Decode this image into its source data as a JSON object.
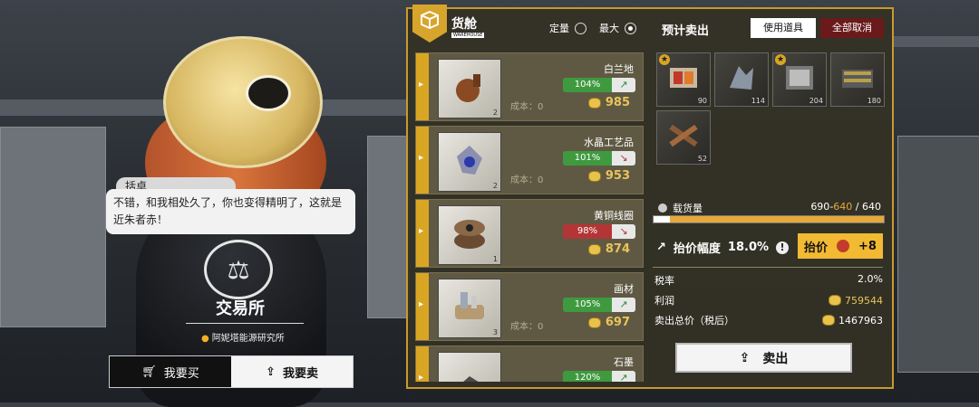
{
  "dialog": {
    "speaker": "括卓",
    "text": "不错，和我相处久了，你也变得精明了，这就是近朱者赤！"
  },
  "location": {
    "title": "交易所",
    "subtitle": "阿妮塔能源研究所"
  },
  "mode": {
    "buy_label": "我要买",
    "sell_label": "我要卖",
    "active": "sell"
  },
  "warehouse": {
    "title": "货舱",
    "badge_top": "WAREHOUSE",
    "badge_sub": "WAREHOUSE",
    "quantity_options": [
      "定量",
      "最大"
    ],
    "selected_option": "最大"
  },
  "forecast": {
    "title": "预计卖出",
    "use_item_label": "使用道具",
    "cancel_all_label": "全部取消"
  },
  "items": [
    {
      "name": "白兰地",
      "qty": "2",
      "percent": "104%",
      "trend": "up",
      "arrow": "↗",
      "cost": "成本：0",
      "price": "985"
    },
    {
      "name": "水晶工艺品",
      "qty": "2",
      "percent": "101%",
      "trend": "up",
      "arrow": "↘",
      "cost": "成本：0",
      "price": "953"
    },
    {
      "name": "黄铜线圈",
      "qty": "1",
      "percent": "98%",
      "trend": "down",
      "arrow": "↘",
      "cost": "",
      "price": "874"
    },
    {
      "name": "画材",
      "qty": "3",
      "percent": "105%",
      "trend": "up",
      "arrow": "↗",
      "cost": "成本：0",
      "price": "697"
    },
    {
      "name": "石墨",
      "qty": "",
      "percent": "120%",
      "trend": "up",
      "arrow": "↗",
      "cost": "",
      "price": ""
    }
  ],
  "sell_slots": [
    {
      "qty": "90",
      "starred": true
    },
    {
      "qty": "114",
      "starred": false
    },
    {
      "qty": "204",
      "starred": true
    },
    {
      "qty": "180",
      "starred": false
    },
    {
      "qty": "52",
      "starred": false
    }
  ],
  "capacity": {
    "label": "载货量",
    "used": "690",
    "after": "640",
    "max": "640",
    "fill_fraction": 1.0
  },
  "raise": {
    "label": "抬价幅度",
    "value": "18.0%",
    "info": "!",
    "button_label": "抬价",
    "button_cost": "+8"
  },
  "summary": {
    "tax_label": "税率",
    "tax_value": "2.0%",
    "profit_label": "利润",
    "profit_value": "759544",
    "total_label": "卖出总价（税后）",
    "total_value": "1467963"
  },
  "sell_button_label": "卖出",
  "colors": {
    "accent": "#d9a624",
    "panel_bg": "#34312a",
    "up": "#3f9a3f",
    "down": "#b33535",
    "gold": "#e8c45a"
  }
}
